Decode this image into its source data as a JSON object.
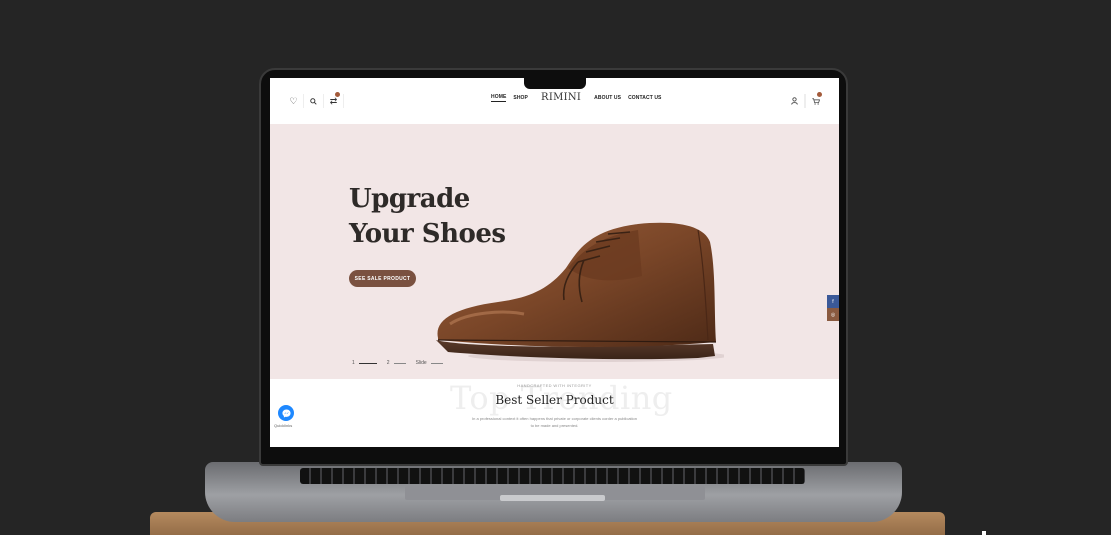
{
  "nav": {
    "left_icons": [
      "heart-icon",
      "search-icon",
      "compare-icon"
    ],
    "links_left": [
      {
        "label": "HOME",
        "active": true
      },
      {
        "label": "SHOP",
        "active": false
      }
    ],
    "logo": "RIMINI",
    "links_right": [
      {
        "label": "ABOUT US",
        "active": false
      },
      {
        "label": "CONTACT US",
        "active": false
      }
    ],
    "right_icons": [
      "user-icon",
      "cart-icon"
    ]
  },
  "hero": {
    "title_line1": "Upgrade",
    "title_line2": "Your Shoes",
    "cta_label": "SEE SALE PRODUCT",
    "background_color": "#f2e6e6",
    "slides": [
      {
        "label": "1",
        "active": true
      },
      {
        "label": "2",
        "active": false
      },
      {
        "label": "Slide",
        "active": false
      }
    ]
  },
  "social": {
    "facebook": "f",
    "instagram": "◎"
  },
  "section": {
    "ghost_text": "Top Trending",
    "eyebrow": "HANDCRAFTED WITH INTEGRITY",
    "title": "Best Seller Product",
    "description": "In a professional context it often happens that private or corporate clients corder a publication to be made and presented."
  },
  "chat": {
    "icon": "messenger-icon",
    "label": "Quicklinks"
  },
  "colors": {
    "accent": "#7a5140",
    "page_bg": "#252525"
  }
}
